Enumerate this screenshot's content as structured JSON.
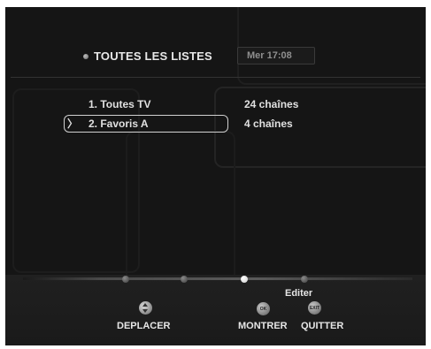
{
  "header": {
    "title": "TOUTES LES LISTES",
    "clock": "Mer 17:08"
  },
  "lists": [
    {
      "name": "1. Toutes TV",
      "count": "24 chaînes",
      "selected": false
    },
    {
      "name": "2. Favoris A",
      "count": "4 chaînes",
      "selected": true
    }
  ],
  "footer": {
    "edit_label": "Editer",
    "move_label": "DEPLACER",
    "show_label": "MONTRER",
    "quit_label": "QUITTER",
    "ok_icon_text": "OK",
    "exit_icon_text": "EXIT"
  },
  "colors": {
    "background": "#151515",
    "text": "#e0e0e0",
    "accent": "#ffffff"
  }
}
